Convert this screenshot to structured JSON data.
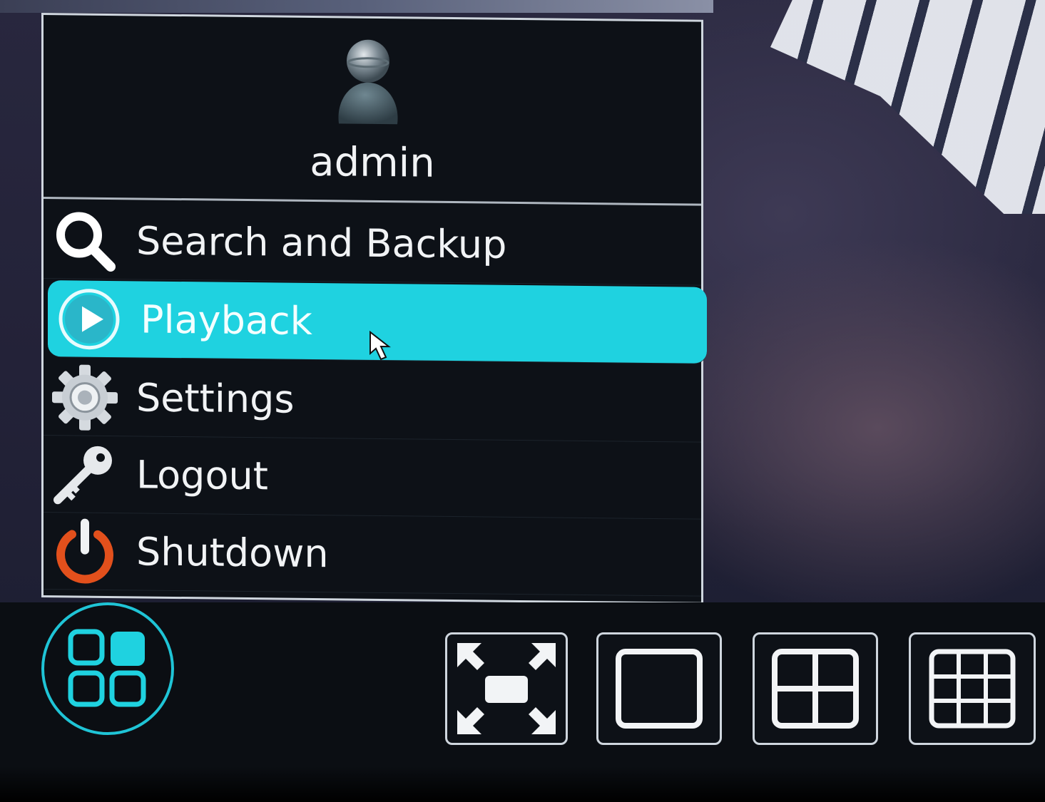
{
  "user": {
    "name": "admin"
  },
  "menu": {
    "items": [
      {
        "label": "Search and Backup",
        "icon": "search-icon",
        "selected": false
      },
      {
        "label": "Playback",
        "icon": "play-icon",
        "selected": true
      },
      {
        "label": "Settings",
        "icon": "gear-icon",
        "selected": false
      },
      {
        "label": "Logout",
        "icon": "key-icon",
        "selected": false
      },
      {
        "label": "Shutdown",
        "icon": "power-icon",
        "selected": false
      }
    ]
  },
  "toolbar": {
    "buttons": [
      {
        "icon": "layout-grid-icon"
      },
      {
        "icon": "fullscreen-icon"
      },
      {
        "icon": "single-view-icon"
      },
      {
        "icon": "quad-view-icon"
      },
      {
        "icon": "nine-view-icon"
      }
    ]
  },
  "colors": {
    "accent": "#1fd2e0",
    "panel": "#0d1117",
    "border": "#cfd6de",
    "shutdown": "#e2501c"
  }
}
